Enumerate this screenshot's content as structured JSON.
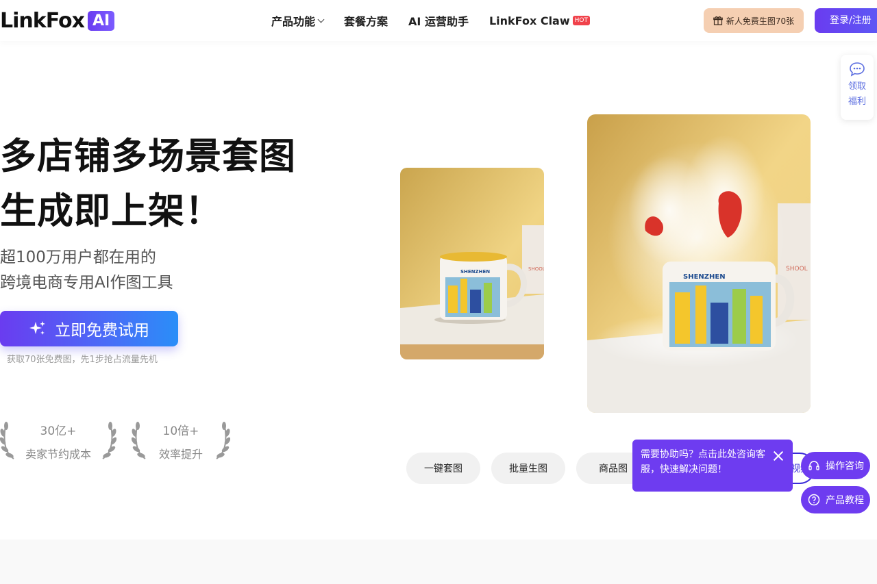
{
  "header": {
    "logo_text": "LinkFox",
    "logo_badge": "AI",
    "nav": [
      {
        "label": "产品功能"
      },
      {
        "label": "套餐方案"
      },
      {
        "label": "AI 运营助手"
      },
      {
        "label": "LinkFox Claw",
        "badge": "HOT"
      }
    ],
    "gift_label": "新人免费生图70张",
    "login_label": "登录/注册"
  },
  "hero": {
    "title_line1": "多店铺多场景套图",
    "title_line2": "生成即上架！",
    "subtitle_line1": "超100万用户都在用的",
    "subtitle_line2": "跨境电商专用AI作图工具",
    "cta_label": "立即免费试用",
    "cta_note": "获取70张免费图，先1步抢占流量先机",
    "stats": [
      {
        "value": "30亿+",
        "label": "卖家节约成本"
      },
      {
        "value": "10倍+",
        "label": "效率提升"
      }
    ]
  },
  "showcase": {
    "mug_text": "SHENZHEN",
    "box_text": "SHOOL",
    "tabs": [
      "一键套图",
      "批量生图",
      "商品图",
      "视频"
    ]
  },
  "welfare": {
    "line1": "领取",
    "line2": "福利"
  },
  "help": {
    "popup_text": "需要协助吗？点击此处咨询客服，快速解决问题！",
    "consult_label": "操作咨询",
    "tutorial_label": "产品教程"
  },
  "colors": {
    "brand": "#6e3cf0",
    "gift_bg": "#f5cfb2",
    "hot": "#f0424b"
  }
}
